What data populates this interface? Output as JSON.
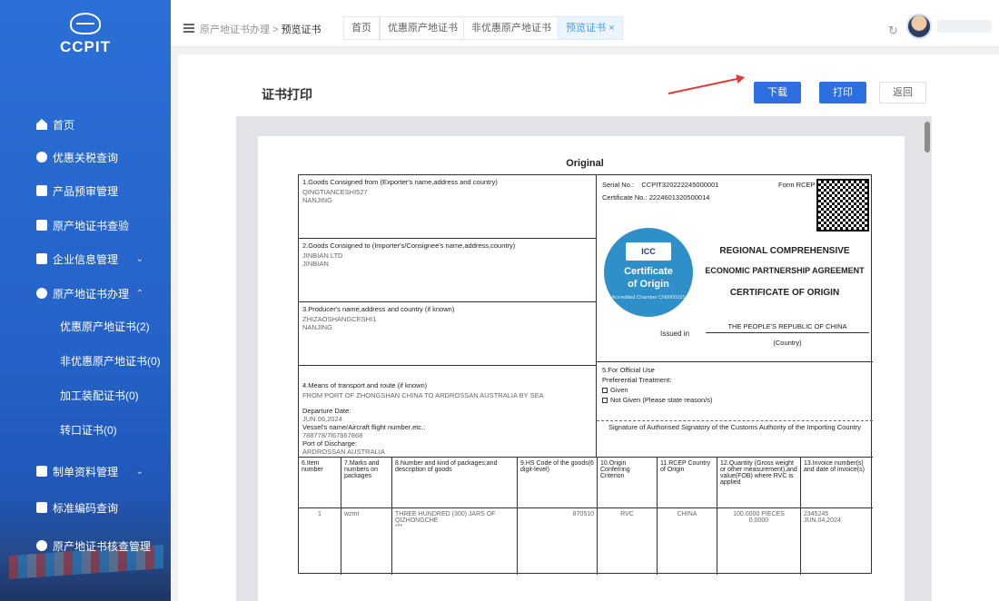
{
  "sidebar": {
    "logo_text": "CCPIT",
    "items": [
      {
        "label": "首页",
        "icon": "home-icon"
      },
      {
        "label": "优惠关税查询",
        "icon": "search-icon"
      },
      {
        "label": "产品预审管理",
        "icon": "briefcase-icon"
      },
      {
        "label": "原产地证书查验",
        "icon": "certificate-check-icon"
      },
      {
        "label": "企业信息管理",
        "icon": "company-icon"
      },
      {
        "label": "原产地证书办理",
        "icon": "person-icon"
      },
      {
        "label": "制单资料管理",
        "icon": "document-icon"
      },
      {
        "label": "标准编码查询",
        "icon": "code-icon"
      },
      {
        "label": "原产地证书核查管理",
        "icon": "user-check-icon"
      }
    ],
    "subitems": [
      "优惠原产地证书(2)",
      "非优惠原产地证书(0)",
      "加工装配证书(0)",
      "转口证书(0)"
    ]
  },
  "topbar": {
    "breadcrumb_parent": "原产地证书办理",
    "breadcrumb_sep": ">",
    "breadcrumb_current": "预览证书",
    "tabs": [
      "首页",
      "优惠原产地证书",
      "非优惠原产地证书",
      "预览证书"
    ],
    "close_glyph": "×",
    "refresh_glyph": "↻"
  },
  "main": {
    "title": "证书打印",
    "buttons": {
      "download": "下载",
      "print": "打印",
      "back": "返回"
    }
  },
  "certificate": {
    "heading": "Original",
    "exporter_label": "1.Goods Consigned from (Exporter's name,address and country)",
    "exporter_value": "QINGTIANCESHI527\nNANJING",
    "consignee_label": "2.Goods Consigned to (Importer's/Consignee's name,address,country)",
    "consignee_value": "JINBIAN LTD\nJINBIAN",
    "producer_label": "3.Producer's name,address and country (if known)",
    "producer_value": "ZHIZAOSHANGCESHI1\nNANJING",
    "transport_label": "4.Means of transport and route (if known)",
    "transport_value": "FROM PORT OF ZHONGSHAN CHINA TO ARDROSSAN AUSTRALIA BY SEA",
    "departure_label": "Departure Date:",
    "departure_value": "JUN.06,2024",
    "vessel_label": "Vessel's name/Aircraft flight number,etc.:",
    "vessel_value": "788778/7l67867868",
    "discharge_label": "Port of Discharge:",
    "discharge_value": "ARDROSSAN AUSTRALIA",
    "serial_label": "Serial No.:",
    "serial_value": "CCPIT320222245000001",
    "form_label": "Form RCEP",
    "cert_no_label": "Certificate No.:",
    "cert_no_value": "2224601320500014",
    "seal_icc": "ICC",
    "seal_line1": "Certificate",
    "seal_line2": "of Origin",
    "seal_line3": "Accredited Chamber CN0000101",
    "rcep_line1": "REGIONAL COMPREHENSIVE",
    "rcep_line2": "ECONOMIC PARTNERSHIP AGREEMENT",
    "rcep_line3": "CERTIFICATE OF ORIGIN",
    "issued_in_label": "Issued in",
    "issued_in_value": "THE PEOPLE'S REPUBLIC OF CHINA",
    "country_label": "(Country)",
    "official_label": "5.For Official Use",
    "preferential_label": "Preferential Treatment:",
    "given_label": "Given",
    "not_given_label": "Not Given (Please state reason/s)",
    "signature_label": "Signature of Authorised Signatory of the Customs Authority of the Importing Country",
    "table_headers": [
      "6.Item number",
      "7.Marks and numbers on packages",
      "8.Number and kind of packages;and description of goods",
      "9.HS Code of the goods(6 digit-level)",
      "10.Origin Conferring Criterion",
      "11.RCEP Country of Origin",
      "12.Quantity (Gross weight or other measurement),and value(FOB) where RVC is applied",
      "13.Invoice number(s) and date of invoice(s)"
    ],
    "table_row": [
      "1",
      "wzmt",
      "THREE HUNDRED (300) JARS OF QIZHONGCHE\n***",
      "870510",
      "RVC",
      "CHINA",
      "100.0000 PIECES\n0.0000",
      "2345245\nJUN.04,2024"
    ]
  },
  "colors": {
    "sidebar": "#2b6fd6",
    "primary_button": "#2d6fe0",
    "active_tab": "#409eff",
    "arrow": "#e53935"
  }
}
